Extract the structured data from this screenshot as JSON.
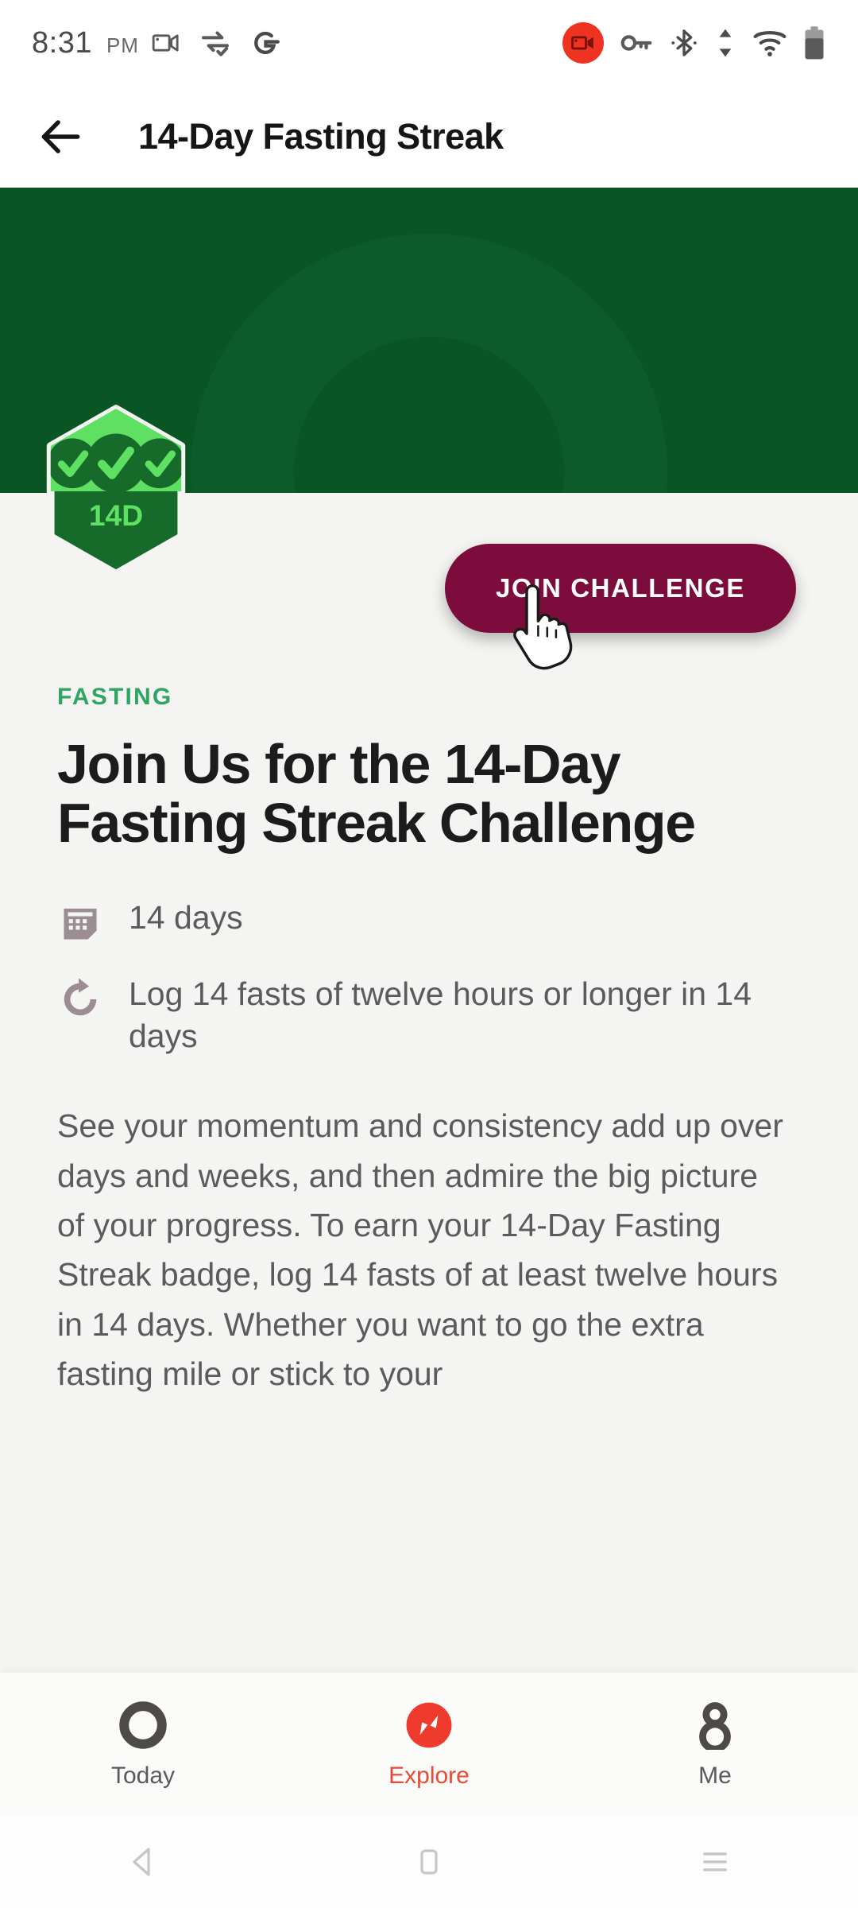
{
  "status_bar": {
    "time": "8:31",
    "ampm": "PM",
    "left_icons": [
      "screen-cast-icon",
      "transfer-check-icon",
      "google-g-icon"
    ],
    "right_icons": [
      "screen-record-icon",
      "vpn-key-icon",
      "bluetooth-icon",
      "data-transfer-icon",
      "wifi-icon",
      "battery-icon"
    ]
  },
  "header": {
    "back_icon": "arrow-left-icon",
    "title": "14-Day Fasting Streak"
  },
  "hero": {
    "background_color": "#0a5524",
    "ring_color": "#0d5b28",
    "badge": {
      "label": "14D",
      "check_count": 3,
      "fill_light": "#5ee063",
      "fill_dark": "#166b2a",
      "border_color": "#f4f4f2"
    }
  },
  "cta": {
    "label": "JOIN CHALLENGE",
    "color": "#7c0c3c",
    "text_color": "#ffffff",
    "cursor": "pointer-hand-cursor"
  },
  "content": {
    "eyebrow": "FASTING",
    "eyebrow_color": "#2fa563",
    "headline": "Join Us for the 14-Day Fasting Streak Challenge",
    "meta": [
      {
        "icon": "calendar-icon",
        "text": "14 days"
      },
      {
        "icon": "repeat-refresh-icon",
        "text": "Log 14 fasts of twelve hours or longer in 14 days"
      }
    ],
    "body": "See your momentum and consistency add up over days and weeks, and then admire the big picture of your progress. To earn your 14-Day Fasting Streak badge, log 14 fasts of at least twelve hours in 14 days. Whether you want to go the extra fasting mile or stick to your"
  },
  "bottom_nav": {
    "active": "Explore",
    "accent_color": "#ea4a33",
    "items": [
      {
        "label": "Today",
        "icon": "circle-ring-icon"
      },
      {
        "label": "Explore",
        "icon": "compass-icon"
      },
      {
        "label": "Me",
        "icon": "person-icon"
      }
    ]
  },
  "android_nav": {
    "items": [
      {
        "name": "back-nav-button",
        "icon": "triangle-back-icon"
      },
      {
        "name": "home-nav-button",
        "icon": "square-home-icon"
      },
      {
        "name": "recents-nav-button",
        "icon": "lines-recents-icon"
      }
    ]
  }
}
